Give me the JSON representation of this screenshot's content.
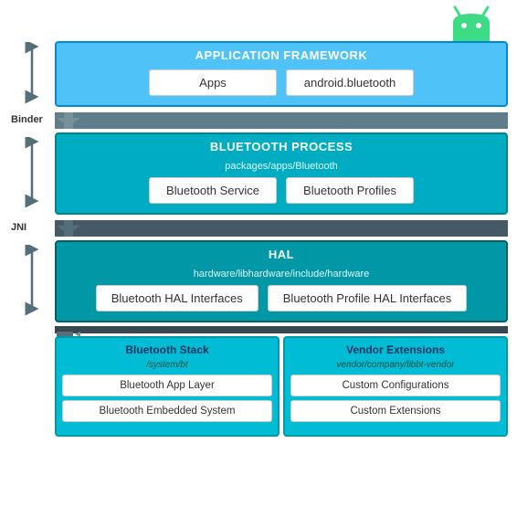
{
  "android_logo": {
    "color_body": "#3DDC84",
    "color_eye": "#fff"
  },
  "app_framework": {
    "title": "APPLICATION FRAMEWORK",
    "cards": [
      "Apps",
      "android.bluetooth"
    ]
  },
  "binder": "Binder",
  "bt_process": {
    "title": "BLUETOOTH PROCESS",
    "sub_path": "packages/apps/Bluetooth",
    "cards": [
      "Bluetooth Service",
      "Bluetooth Profiles"
    ]
  },
  "jni": "JNI",
  "hal": {
    "title": "HAL",
    "sub_path": "hardware/libhardware/include/hardware",
    "cards": [
      "Bluetooth HAL Interfaces",
      "Bluetooth Profile HAL Interfaces"
    ]
  },
  "bt_stack": {
    "title": "Bluetooth Stack",
    "sub_path": "/system/bt",
    "cards": [
      "Bluetooth App Layer",
      "Bluetooth Embedded System"
    ]
  },
  "vendor_ext": {
    "title": "Vendor Extensions",
    "sub_path": "vendor/company/libbt-vendor",
    "cards": [
      "Custom Configurations",
      "Custom Extensions"
    ]
  }
}
